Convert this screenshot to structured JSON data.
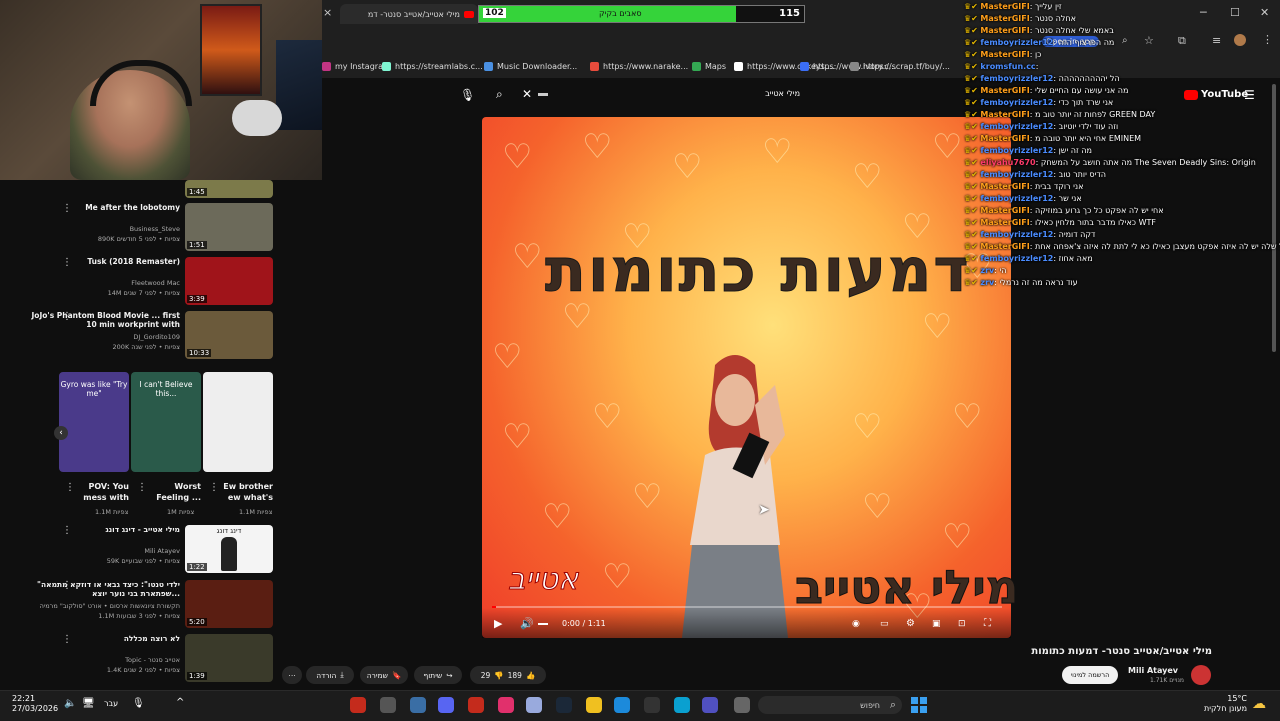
{
  "browser": {
    "tab_title": "מילי אטייב/אטייב סנטר- דמ",
    "goal": {
      "current": "102",
      "label": "סאבים בקיק",
      "target": "115",
      "progress": 0.887
    },
    "close_tab": "×",
    "window": {
      "minimize": "─",
      "maximize": "☐",
      "close": "✕"
    },
    "bookmarks": [
      {
        "label": "my Instagram",
        "color": "#c13584"
      },
      {
        "label": "https://streamlabs.c...",
        "color": "#80f5d2"
      },
      {
        "label": "Music Downloader...",
        "color": "#4a90e2"
      },
      {
        "label": "https://www.narake...",
        "color": "#e74c3c"
      },
      {
        "label": "Maps",
        "color": "#34a853"
      },
      {
        "label": "https://www.cdkeys....",
        "color": "#ffffff"
      },
      {
        "label": "https://www.ivory.c...",
        "color": "#3b6ef5"
      },
      {
        "label": "https://scrap.tf/buy/...",
        "color": "#888888"
      }
    ],
    "open_in_app": "Open in app"
  },
  "youtube": {
    "logo_text": "YouTube",
    "search_value": "מילי אטייב",
    "player": {
      "time": "0:00 / 1:11",
      "art_title": "דמעות כתומות",
      "art_artist": "מילי אטייב",
      "art_signature": "אטייב"
    },
    "video_title": "מילי אטייב/אטייב סנטר- דמעות כתומות",
    "channel": {
      "name": "Mili Atayev",
      "subs": "1.71K מנויים",
      "subscribe_label": "הרשמה למינוי"
    },
    "actions": {
      "likes": "189",
      "dislikes": "29",
      "share": "שיתוף",
      "save": "שמירה",
      "download": "הורדה",
      "more": "⋯"
    }
  },
  "sidebar": {
    "videos": [
      {
        "title": "Me after the lobotomy",
        "channel": "Business_Steve",
        "meta": "890K צפיות • לפני 5 חודשים",
        "duration": "1:51"
      },
      {
        "title": "Tusk (2018 Remaster)",
        "channel": "Fleetwood Mac",
        "meta": "14M צפיות • לפני 7 שנים",
        "duration": "3:39"
      },
      {
        "title": "JoJo's Phantom Blood Movie ... first 10 min workprint with",
        "channel": "DJ_Gordito109",
        "meta": "200K צפיות • לפני שנה",
        "duration": "10:33"
      },
      {
        "title": "מילי אטייב - דינג דונג",
        "channel": "Mili Atayev",
        "meta": "59K צפיות • לפני שבועיים",
        "duration": "1:22"
      },
      {
        "title": "\"ילדי טנטו\": כיצד גבאי או דוזקא מתמאה שפתארת בני נוער יוצא...",
        "channel": "תקשורת ציונאשות ארסום • אורט \"סולקוב\" מרמיה",
        "meta": "1.1M צפיות • לפני 3 שבועות",
        "duration": "5:20"
      },
      {
        "title": "לא רוצה מכללה",
        "channel": "Topic - אטייב סנטר",
        "meta": "1.4K צפיות • לפני 2 שנים",
        "duration": "1:39"
      }
    ],
    "top_duration": "1:45",
    "shorts": [
      {
        "title": "POV: You mess with",
        "views": "1.1M צפיות",
        "overlay": "Gyro was like \"Try me\""
      },
      {
        "title": "Worst Feeling ...",
        "views": "1M צפיות",
        "overlay": "I can't Believe this..."
      },
      {
        "title": "Ew brother ew what's",
        "views": "1.1M צפיות",
        "overlay": ""
      }
    ],
    "thumb_dingdong": "דינג דונג"
  },
  "chat": [
    {
      "name": "MasterGIFI",
      "text": "זין עלייך",
      "color": "#ff9f1a"
    },
    {
      "name": "MasterGIFI",
      "text": "אחלה סנטר",
      "color": "#ff9f1a"
    },
    {
      "name": "MasterGIFI",
      "text": "באמא שלי אחלה סנטר",
      "color": "#ff9f1a"
    },
    {
      "name": "femboyrizzler12",
      "text": "מה הפרצוף הזה",
      "color": "#4a8cff"
    },
    {
      "name": "MasterGIFI",
      "text": "כן",
      "color": "#ff9f1a"
    },
    {
      "name": "kromsfun.cc",
      "text": "",
      "color": "#4a8cff"
    },
    {
      "name": "femboyrizzler12",
      "text": "הל יההההההההה",
      "color": "#4a8cff"
    },
    {
      "name": "MasterGIFI",
      "text": "מה אני עושה עם החיים שלי",
      "color": "#ff9f1a"
    },
    {
      "name": "femboyrizzler12",
      "text": "אני שרד תוך כדי",
      "color": "#4a8cff"
    },
    {
      "name": "MasterGIFI",
      "text": "לפחות זה יותר טוב מ GREEN DAY",
      "color": "#ff9f1a"
    },
    {
      "name": "femboyrizzler12",
      "text": "וזה עוד ילדי יוטיוב",
      "color": "#4a8cff"
    },
    {
      "name": "MasterGIFI",
      "text": "אחי היא יותר טובה מ EMINEM",
      "color": "#ff9f1a"
    },
    {
      "name": "femboyrizzler12",
      "text": "מה זה ישן",
      "color": "#4a8cff"
    },
    {
      "name": "eliyahu7670",
      "text": "מה אתה חושב על המשחק The Seven Deadly Sins: Origin",
      "color": "#ff3b6b"
    },
    {
      "name": "femboyrizzler12",
      "text": "הדיס יותר טוב",
      "color": "#4a8cff"
    },
    {
      "name": "MasterGIFI",
      "text": "אני רוקד בבית",
      "color": "#ff9f1a"
    },
    {
      "name": "femboyrizzler12",
      "text": "אני שר",
      "color": "#4a8cff"
    },
    {
      "name": "MasterGIFI",
      "text": "אחי יש לה אפקט כל כך גרוע במוזיקה",
      "color": "#ff9f1a"
    },
    {
      "name": "MasterGIFI",
      "text": "כאילו מדבר בתור מלחין כאילו WTF",
      "color": "#ff9f1a"
    },
    {
      "name": "femboyrizzler12",
      "text": "דקה דומיה",
      "color": "#4a8cff"
    },
    {
      "name": "MasterGIFI",
      "text": "קול שלה יש לה איזה אפקט מעצבן כאילו כא לי לתת לה איזה צ'אפחה אחת",
      "color": "#ff9f1a"
    },
    {
      "name": "femboyrizzler12",
      "text": "מאה אחוז",
      "color": "#4a8cff"
    },
    {
      "name": "zrv",
      "text": "הי",
      "color": "#4a8cff"
    },
    {
      "name": "zrv",
      "text": "עוד נראה מה זה נרמלי",
      "color": "#4a8cff"
    }
  ],
  "taskbar": {
    "time": "22:21",
    "date": "27/03/2026",
    "search_placeholder": "חיפוש",
    "weather_temp": "15°C",
    "weather_desc": "מעונן חלקית",
    "lang": "עבר"
  }
}
